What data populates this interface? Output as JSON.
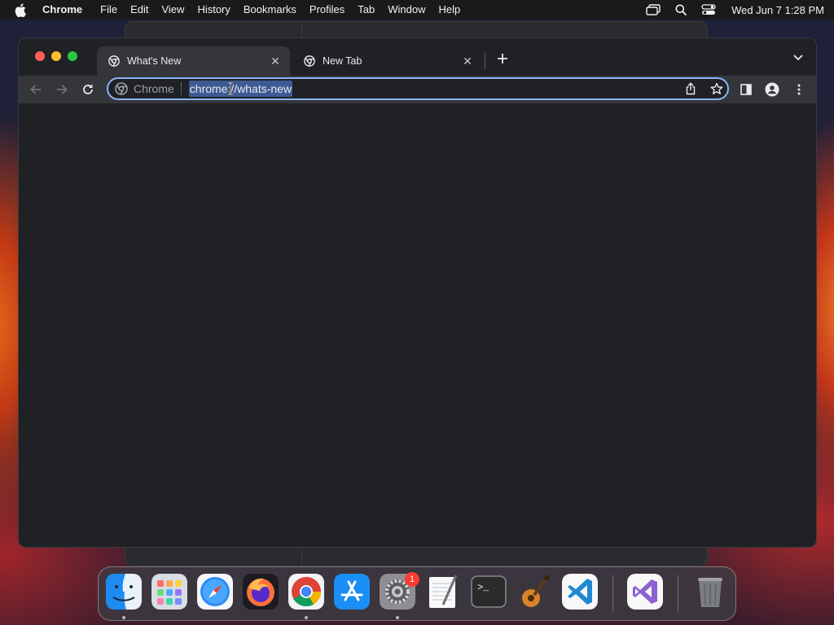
{
  "menubar": {
    "app_name": "Chrome",
    "items": [
      "File",
      "Edit",
      "View",
      "History",
      "Bookmarks",
      "Profiles",
      "Tab",
      "Window",
      "Help"
    ],
    "clock": "Wed Jun 7  1:28 PM",
    "status_icons": [
      "screen-mirroring-icon",
      "spotlight-search-icon",
      "control-center-icon"
    ]
  },
  "browser": {
    "tabs": [
      {
        "title": "What's New",
        "active": true,
        "icon": "chrome-favicon-icon"
      },
      {
        "title": "New Tab",
        "active": false,
        "icon": "chrome-favicon-icon"
      }
    ],
    "omnibox": {
      "chip_label": "Chrome",
      "url": "chrome://whats-new",
      "url_selected": true
    },
    "colors": {
      "frame": "#202124",
      "toolbar": "#35363a",
      "focus_ring": "#8ab4f8",
      "selection": "#3d5a93"
    }
  },
  "dock": {
    "apps": [
      {
        "name": "Finder",
        "icon": "finder-icon",
        "running": true
      },
      {
        "name": "Launchpad",
        "icon": "launchpad-icon",
        "running": false
      },
      {
        "name": "Safari",
        "icon": "safari-icon",
        "running": false
      },
      {
        "name": "Firefox",
        "icon": "firefox-icon",
        "running": false
      },
      {
        "name": "Google Chrome",
        "icon": "chrome-icon",
        "running": true
      },
      {
        "name": "App Store",
        "icon": "app-store-icon",
        "running": false
      },
      {
        "name": "System Settings",
        "icon": "system-settings-icon",
        "running": true,
        "badge": "1"
      },
      {
        "name": "TextEdit",
        "icon": "textedit-icon",
        "running": false
      },
      {
        "name": "Terminal",
        "icon": "terminal-icon",
        "running": false
      },
      {
        "name": "GarageBand",
        "icon": "garageband-icon",
        "running": false
      },
      {
        "name": "Visual Studio Code",
        "icon": "vscode-icon",
        "running": false
      },
      {
        "name": "Visual Studio",
        "icon": "visual-studio-icon",
        "running": false
      },
      {
        "name": "Trash",
        "icon": "trash-icon",
        "running": false
      }
    ],
    "settings_badge": "1"
  }
}
